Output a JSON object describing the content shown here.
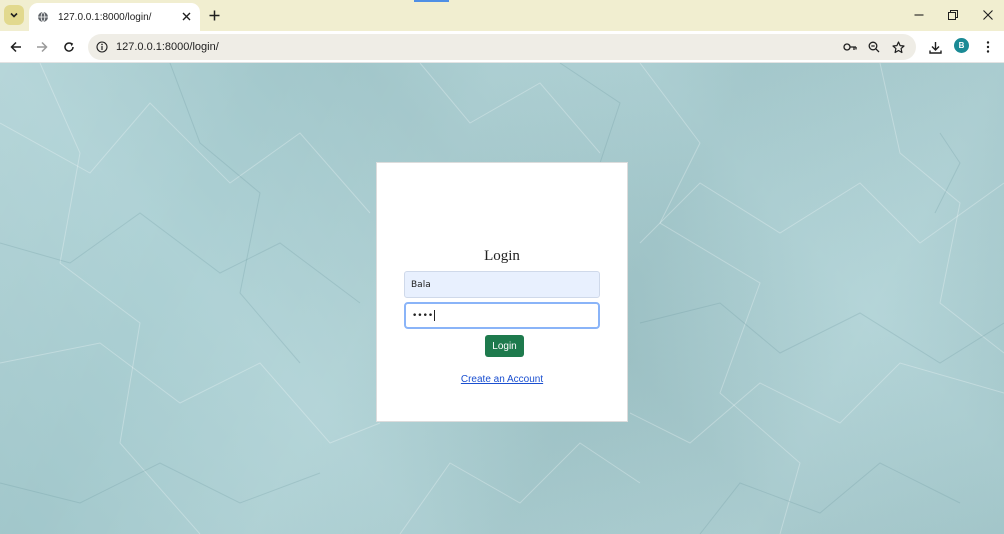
{
  "browser": {
    "tab": {
      "title": "127.0.0.1:8000/login/"
    },
    "address_bar": {
      "url": "127.0.0.1:8000/login/"
    },
    "profile": {
      "initial": "B",
      "color": "#1a8a95"
    },
    "icons": {
      "tab_search": "chevron-down-icon",
      "favicon": "globe-icon",
      "tab_close": "close-icon",
      "new_tab": "plus-icon",
      "minimize": "minimize-icon",
      "restore": "restore-icon",
      "window_close": "close-icon",
      "back": "arrow-left-icon",
      "forward": "arrow-right-icon",
      "reload": "reload-icon",
      "site_info": "info-icon",
      "passwords": "key-icon",
      "zoom": "zoom-icon",
      "bookmark": "star-icon",
      "downloads": "download-icon",
      "menu": "kebab-menu-icon"
    }
  },
  "page": {
    "background_color": "#a6cdd1",
    "login_form": {
      "title": "Login",
      "username_value": "Bala",
      "password_masked": "••••",
      "submit_label": "Login",
      "submit_color": "#1e7a4d",
      "create_account_label": "Create an Account",
      "link_color": "#1a4fd0"
    }
  }
}
